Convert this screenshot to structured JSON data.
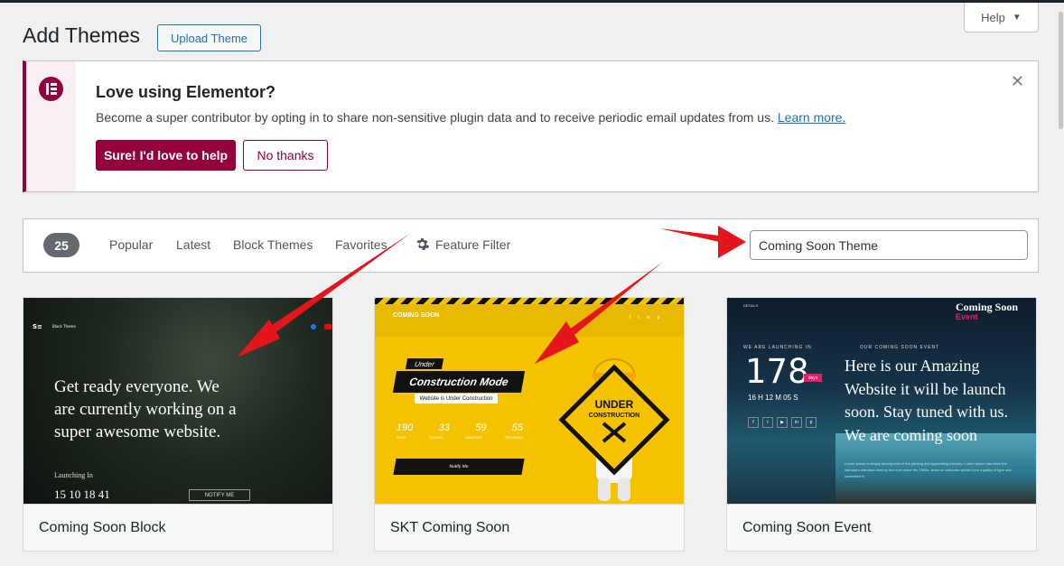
{
  "header": {
    "title": "Add Themes",
    "upload_label": "Upload Theme",
    "help_label": "Help"
  },
  "notice": {
    "title": "Love using Elementor?",
    "text": "Become a super contributor by opting in to share non-sensitive plugin data and to receive periodic email updates from us.",
    "link": "Learn more.",
    "yes_label": "Sure! I'd love to help",
    "no_label": "No thanks",
    "accent_color": "#93003c"
  },
  "filter": {
    "count": "25",
    "tabs": [
      "Popular",
      "Latest",
      "Block Themes",
      "Favorites"
    ],
    "feature_filter": "Feature Filter",
    "search_value": "Coming Soon Theme"
  },
  "themes": [
    {
      "name": "Coming Soon Block",
      "preview": {
        "brand": "Block Theme",
        "headline": "Get ready everyone. We are currently working on a super awesome website.",
        "launching": "Launching In",
        "countdown": "15 10 18 41",
        "notify": "NOTIFY ME"
      }
    },
    {
      "name": "SKT Coming Soon",
      "preview": {
        "logo": "COMING SOON",
        "tag": "Under",
        "headline": "Construction Mode",
        "sub": "Website is Under Construction",
        "numbers": [
          "190",
          "33",
          "59",
          "55"
        ],
        "number_labels": [
          "DAYS",
          "HOURS",
          "MINUTES",
          "SECONDS"
        ],
        "notify": "Notify Me",
        "sign_line1": "UNDER",
        "sign_line2": "CONSTRUCTION"
      }
    },
    {
      "name": "Coming Soon Event",
      "preview": {
        "details": "DETAILS",
        "launching": "WE ARE LAUNCHING IN",
        "days_count": "178",
        "days_label": "days",
        "hms": "16 H 12 M 05 S",
        "event_label": "OUR COMING SOON EVENT",
        "headline": "Here is our Amazing Website it will be launch soon. Stay tuned with us. We are coming soon",
        "brand_line1": "Coming Soon",
        "brand_line2": "Event",
        "body": "Lorem Ipsum is simply dummy text of the printing and typesetting industry. Lorem Ipsum has been the industry's standard dummy text ever since the 1500s, when an unknown printer took a galley of type and scrambled it."
      }
    }
  ],
  "colors": {
    "admin_blue": "#2271b1",
    "arrow_red": "#e4161b"
  }
}
